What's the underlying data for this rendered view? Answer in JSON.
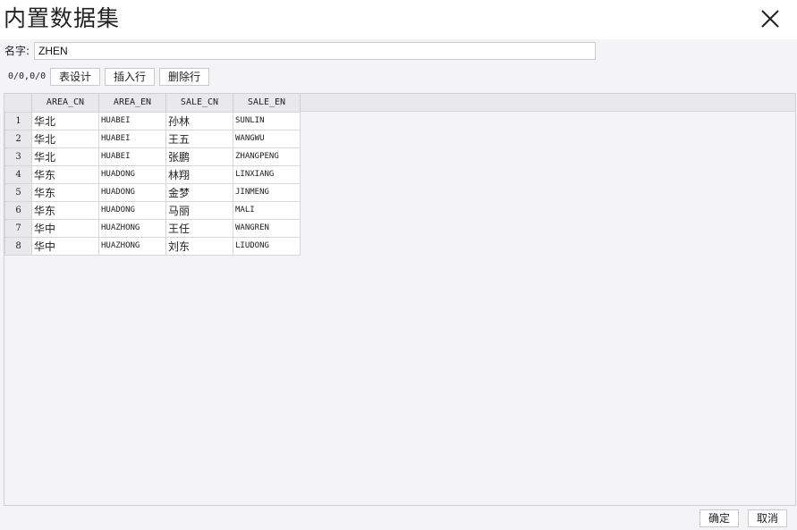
{
  "dialog": {
    "title": "内置数据集"
  },
  "name_field": {
    "label": "名字:",
    "value": "ZHEN"
  },
  "toolbar": {
    "counter": "0/0,0/0",
    "design_label": "表设计",
    "insert_label": "插入行",
    "delete_label": "删除行"
  },
  "table": {
    "columns": [
      "AREA_CN",
      "AREA_EN",
      "SALE_CN",
      "SALE_EN"
    ],
    "rows": [
      {
        "num": "1",
        "cells": [
          "华北",
          "HUABEI",
          "孙林",
          "SUNLIN"
        ]
      },
      {
        "num": "2",
        "cells": [
          "华北",
          "HUABEI",
          "王五",
          "WANGWU"
        ]
      },
      {
        "num": "3",
        "cells": [
          "华北",
          "HUABEI",
          "张鹏",
          "ZHANGPENG"
        ]
      },
      {
        "num": "4",
        "cells": [
          "华东",
          "HUADONG",
          "林翔",
          "LINXIANG"
        ]
      },
      {
        "num": "5",
        "cells": [
          "华东",
          "HUADONG",
          "金梦",
          "JINMENG"
        ]
      },
      {
        "num": "6",
        "cells": [
          "华东",
          "HUADONG",
          "马丽",
          "MALI"
        ]
      },
      {
        "num": "7",
        "cells": [
          "华中",
          "HUAZHONG",
          "王任",
          "WANGREN"
        ]
      },
      {
        "num": "8",
        "cells": [
          "华中",
          "HUAZHONG",
          "刘东",
          "LIUDONG"
        ]
      }
    ]
  },
  "footer": {
    "ok_label": "确定",
    "cancel_label": "取消"
  },
  "icons": {
    "close": "close-icon"
  }
}
